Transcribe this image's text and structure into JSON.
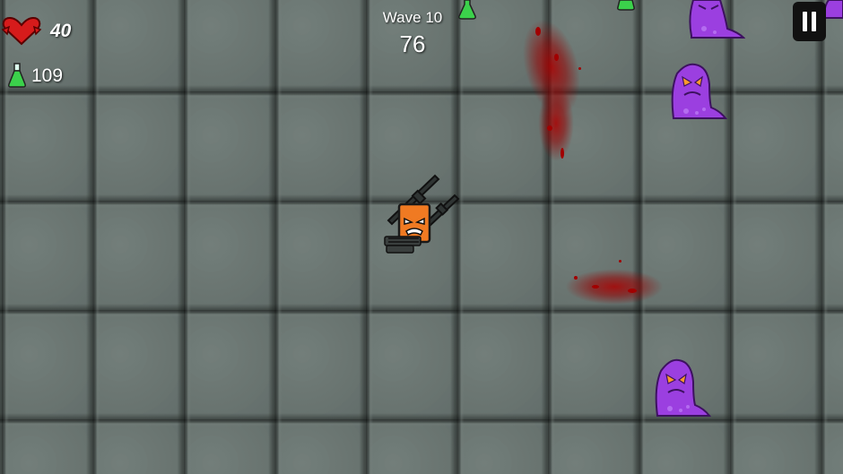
{
  "hud": {
    "health_value": "40",
    "potion_count": "109",
    "wave_label": "Wave 10",
    "wave_timer": "76"
  },
  "colors": {
    "health": "#d61b1b",
    "potion": "#3bd14b",
    "monster": "#9b3fe0",
    "player": "#f07a22",
    "blood": "#a10000"
  },
  "icons": {
    "health": "heart-icon",
    "potion": "potion-flask-icon",
    "pause": "pause-icon"
  }
}
